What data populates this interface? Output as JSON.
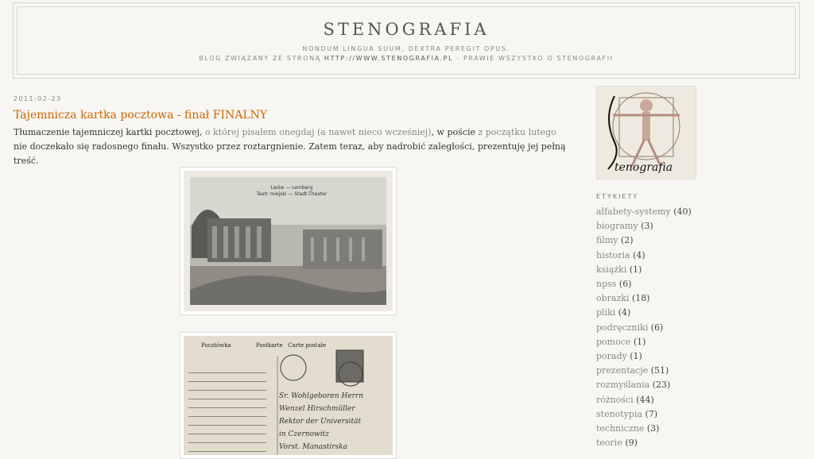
{
  "header": {
    "title": "STENOGRAFIA",
    "motto": "NONDUM LINGUA SUUM, DEXTRA PEREGIT OPUS.",
    "description_prefix": "BLOG ZWIĄZANY ZE STRONĄ ",
    "description_url": "HTTP://WWW.STENOGRAFIA.PL",
    "description_suffix": " - PRAWIE WSZYSTKO O STENOGRAFII"
  },
  "post": {
    "date": "2011-02-23",
    "title": "Tajemnicza kartka pocztowa - finał FINALNY",
    "body": {
      "t1": "Tłumaczenie tajemniczej kartki pocztowej, ",
      "l1": "o której pisałem onegdaj",
      "t2": " ",
      "l2": "(a nawet nieco wcześniej)",
      "t3": ", w poście ",
      "l3": "z początku lutego",
      "t4": " nie doczekało się radosnego finału. Wszystko przez roztargnienie. Zatem teraz, aby nadrobić zaległości, prezentuję jej pełną treść."
    },
    "image1": {
      "caption1": "Lwów — Lemberg",
      "caption2": "Teatr miejski — Stadt-Theater"
    },
    "image2": {
      "head1": "Pocztówka",
      "head2": "Postkarte",
      "head3": "Carte postale",
      "line1": "Sr. Wohlgeboren Herrn",
      "line2": "Wenzel Hirschmüller",
      "line3": "Rektor der Universität",
      "line4": "in Czernowitz",
      "line5": "Vorst. Manastirska"
    }
  },
  "sidebar": {
    "logo_text": "tenografia",
    "labels_heading": "ETYKIETY",
    "labels": [
      {
        "name": "alfabety-systemy",
        "count": "(40)"
      },
      {
        "name": "biogramy",
        "count": "(3)"
      },
      {
        "name": "filmy",
        "count": "(2)"
      },
      {
        "name": "historia",
        "count": "(4)"
      },
      {
        "name": "książki",
        "count": "(1)"
      },
      {
        "name": "npss",
        "count": "(6)"
      },
      {
        "name": "obrazki",
        "count": "(18)"
      },
      {
        "name": "pliki",
        "count": "(4)"
      },
      {
        "name": "podręczniki",
        "count": "(6)"
      },
      {
        "name": "pomoce",
        "count": "(1)"
      },
      {
        "name": "porady",
        "count": "(1)"
      },
      {
        "name": "prezentacje",
        "count": "(51)"
      },
      {
        "name": "rozmyślania",
        "count": "(23)"
      },
      {
        "name": "różności",
        "count": "(44)"
      },
      {
        "name": "stenotypia",
        "count": "(7)"
      },
      {
        "name": "techniczne",
        "count": "(3)"
      },
      {
        "name": "teorie",
        "count": "(9)"
      }
    ]
  },
  "colors": {
    "background": "#f7f6f2",
    "title_accent": "#cc6600",
    "link": "#888888"
  }
}
